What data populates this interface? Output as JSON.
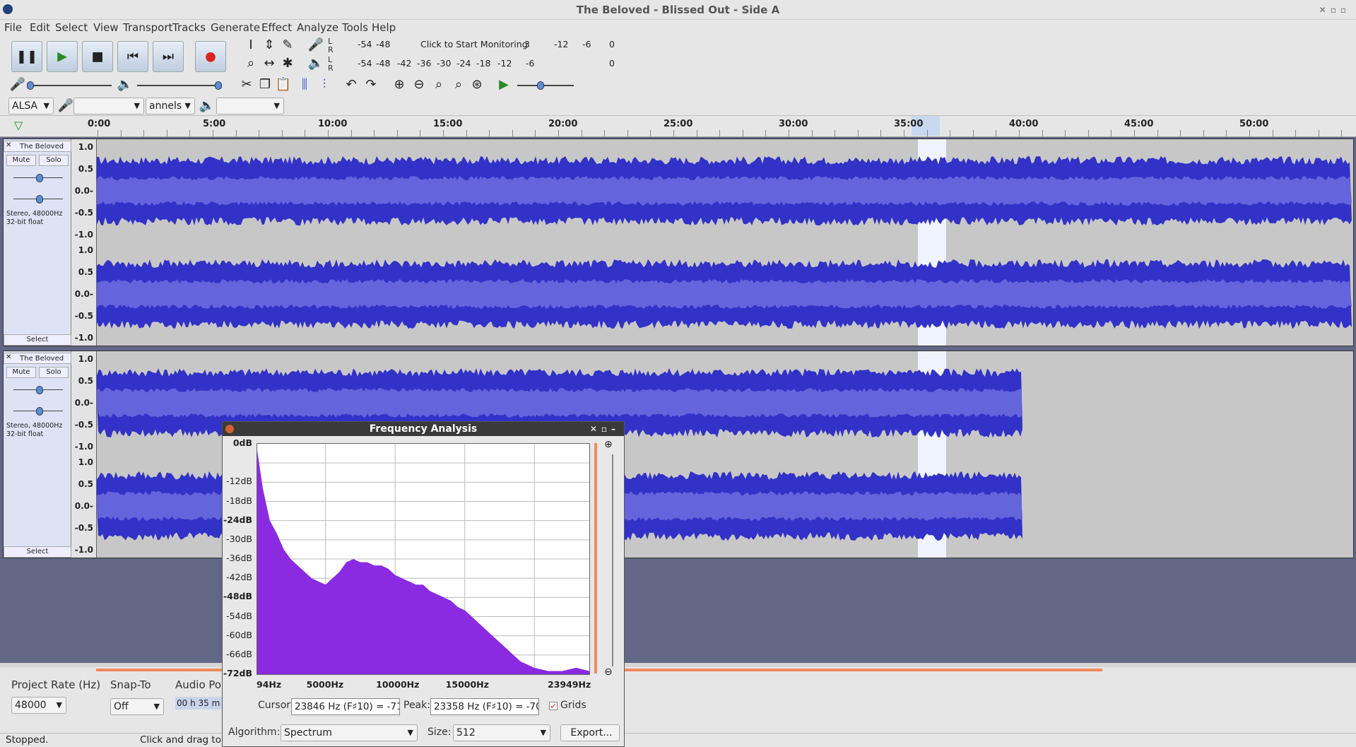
{
  "window": {
    "title": "The Beloved - Blissed Out - Side A"
  },
  "menu": [
    "File",
    "Edit",
    "Select",
    "View",
    "Transport",
    "Tracks",
    "Generate",
    "Effect",
    "Analyze",
    "Tools",
    "Help"
  ],
  "meter": {
    "rec_label": "Click to Start Monitoring",
    "rec_scale": [
      "-54",
      "-48",
      "3",
      "-12",
      "-6",
      "0"
    ],
    "play_scale": [
      "-54",
      "-48",
      "-42",
      "-36",
      "-30",
      "-24",
      "-18",
      "-12",
      "-6",
      "0"
    ]
  },
  "device": {
    "host": "ALSA",
    "channels": "annels"
  },
  "ruler": [
    "0:00",
    "5:00",
    "10:00",
    "15:00",
    "20:00",
    "25:00",
    "30:00",
    "35:00",
    "40:00",
    "45:00",
    "50:00"
  ],
  "tracks": [
    {
      "name": "The Beloved",
      "mute": "Mute",
      "solo": "Solo",
      "info1": "Stereo, 48000Hz",
      "info2": "32-bit float",
      "select": "Select",
      "scale": [
        "1.0",
        "0.5",
        "0.0-",
        "-0.5",
        "-1.0"
      ]
    },
    {
      "name": "The Beloved",
      "mute": "Mute",
      "solo": "Solo",
      "info1": "Stereo, 48000Hz",
      "info2": "32-bit float",
      "select": "Select",
      "scale": [
        "1.0",
        "0.5",
        "0.0-",
        "-0.5",
        "-1.0"
      ]
    }
  ],
  "bottom": {
    "rate_label": "Project Rate (Hz)",
    "rate": "48000",
    "snap_label": "Snap-To",
    "snap": "Off",
    "audio_pos": "Audio Po",
    "time": "00 h 35 m"
  },
  "status": {
    "left": "Stopped.",
    "hint": "Click and drag to"
  },
  "freq": {
    "title": "Frequency Analysis",
    "y_ticks": [
      "0dB",
      "-12dB",
      "-18dB",
      "-24dB",
      "-30dB",
      "-36dB",
      "-42dB",
      "-48dB",
      "-54dB",
      "-60dB",
      "-66dB",
      "-72dB"
    ],
    "x_ticks": [
      "94Hz",
      "5000Hz",
      "10000Hz",
      "15000Hz",
      "23949Hz"
    ],
    "cursor_label": "Cursor:",
    "cursor": "23846 Hz (F♯10) = -71",
    "peak_label": "Peak:",
    "peak": "23358 Hz (F♯10) = -70",
    "grids": "Grids",
    "algorithm_label": "Algorithm:",
    "algorithm": "Spectrum",
    "size_label": "Size:",
    "size": "512",
    "export": "Export..."
  },
  "chart_data": {
    "type": "area",
    "x": [
      94,
      500,
      1000,
      1500,
      2000,
      2500,
      3000,
      3500,
      4000,
      4500,
      5000,
      5500,
      6000,
      6500,
      7000,
      7500,
      8000,
      8500,
      9000,
      9500,
      10000,
      10500,
      11000,
      11500,
      12000,
      12500,
      13000,
      13500,
      14000,
      14500,
      15000,
      16000,
      17000,
      18000,
      19000,
      20000,
      21000,
      22000,
      23000,
      23949
    ],
    "values": [
      -2,
      -14,
      -24,
      -28,
      -33,
      -36,
      -38,
      -40,
      -42,
      -43,
      -44,
      -42,
      -40,
      -37,
      -36,
      -37,
      -37,
      -38,
      -38,
      -39,
      -41,
      -42,
      -43,
      -44,
      -44,
      -46,
      -47,
      -48,
      -49,
      -51,
      -52,
      -56,
      -60,
      -64,
      -68,
      -70,
      -71,
      -71,
      -70,
      -71
    ],
    "color": "#8a2be2",
    "xlim": [
      94,
      23949
    ],
    "ylim": [
      -72,
      0
    ],
    "grid": true
  }
}
